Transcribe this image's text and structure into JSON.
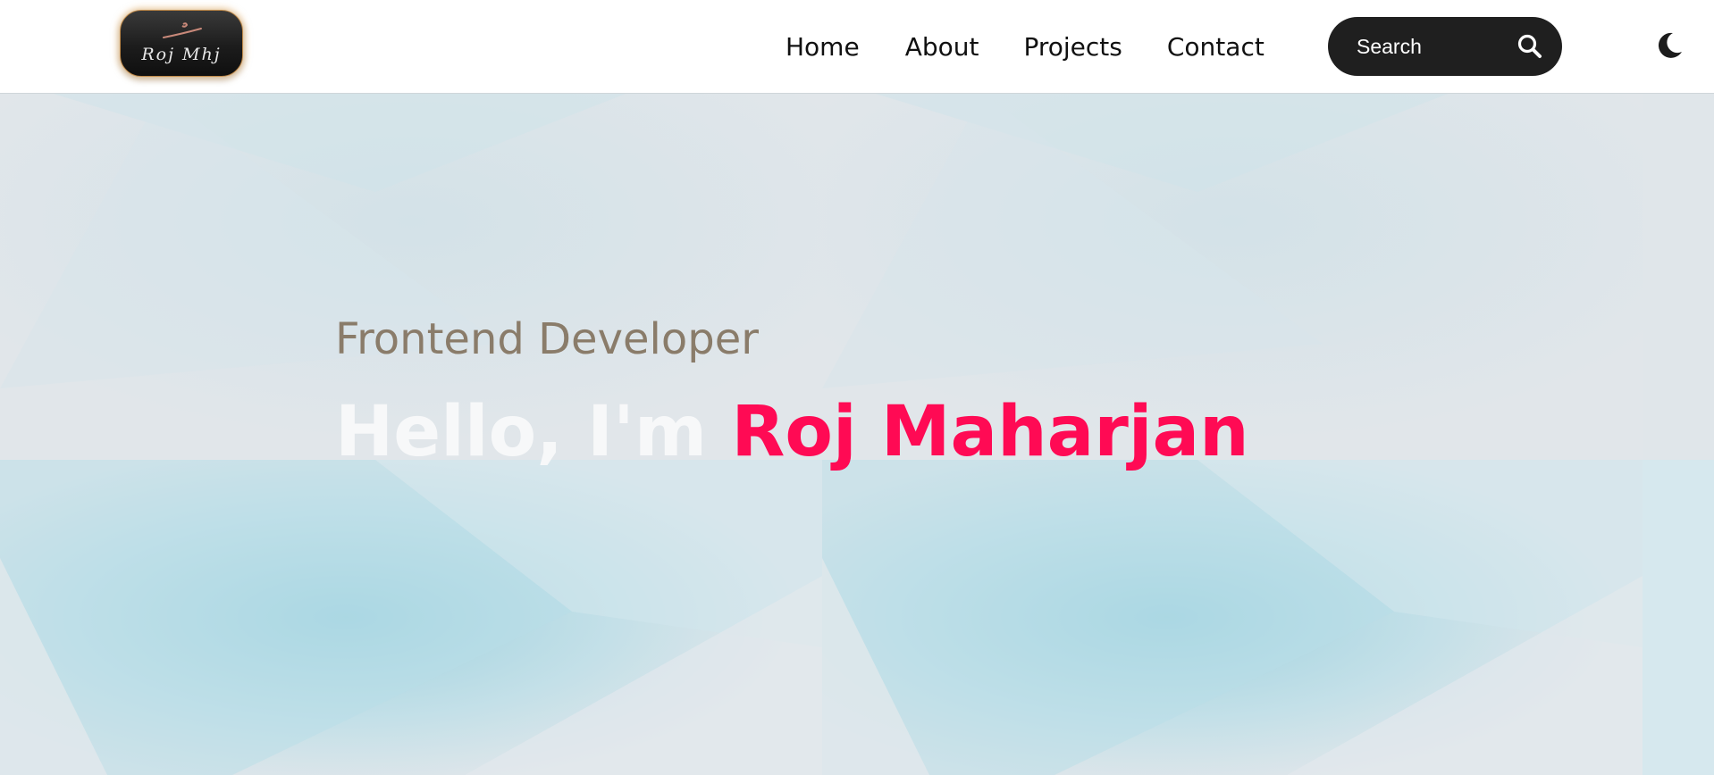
{
  "header": {
    "logo": {
      "text": "Roj Mhj"
    },
    "nav": {
      "items": [
        {
          "label": "Home"
        },
        {
          "label": "About"
        },
        {
          "label": "Projects"
        },
        {
          "label": "Contact"
        }
      ]
    },
    "search": {
      "placeholder": "Search",
      "icon": "search-icon"
    },
    "theme_toggle": {
      "icon": "moon-icon"
    }
  },
  "hero": {
    "subtitle": "Frontend Developer",
    "greeting": "Hello, I'm ",
    "name": "Roj Maharjan"
  },
  "colors": {
    "accent": "#ff0a54",
    "subtitle": "#8a7c6a",
    "nav_bg": "#ffffff",
    "search_bg": "#1f1f1f"
  }
}
